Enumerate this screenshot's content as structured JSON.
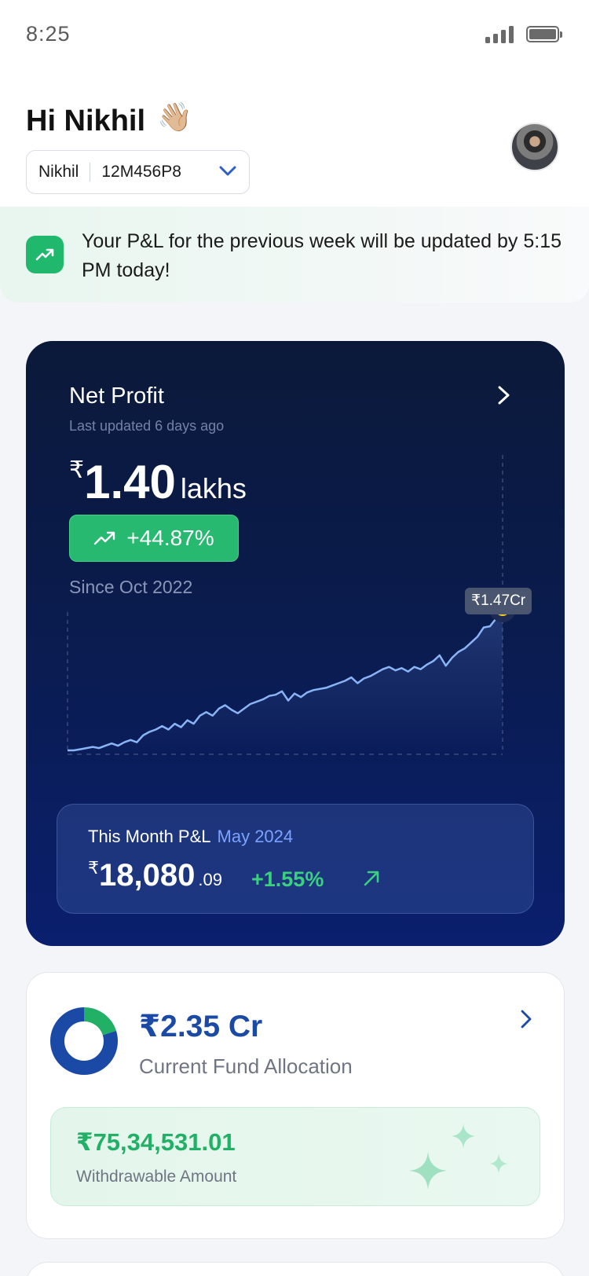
{
  "status_bar": {
    "time": "8:25"
  },
  "header": {
    "greeting": "Hi Nikhil",
    "wave_emoji": "👋🏼",
    "account_name": "Nikhil",
    "account_code": "12M456P8"
  },
  "notice": {
    "text": "Your P&L for the previous week will be updated by 5:15 PM today!"
  },
  "net_profit": {
    "title": "Net Profit",
    "updated": "Last updated 6 days ago",
    "currency": "₹",
    "value": "1.40",
    "unit": "lakhs",
    "change": "+44.87%",
    "since": "Since Oct 2022",
    "tooltip": "₹1.47Cr"
  },
  "chart_data": {
    "type": "line",
    "series": [
      {
        "values": [
          0.02,
          0.02,
          0.03,
          0.04,
          0.05,
          0.04,
          0.06,
          0.08,
          0.06,
          0.09,
          0.11,
          0.09,
          0.15,
          0.18,
          0.2,
          0.23,
          0.2,
          0.25,
          0.22,
          0.28,
          0.25,
          0.32,
          0.35,
          0.32,
          0.38,
          0.41,
          0.37,
          0.34,
          0.38,
          0.42,
          0.44,
          0.46,
          0.49,
          0.5,
          0.53,
          0.45,
          0.51,
          0.48,
          0.52,
          0.54,
          0.55,
          0.56,
          0.58,
          0.6,
          0.62,
          0.65,
          0.6,
          0.64,
          0.66,
          0.69,
          0.72,
          0.74,
          0.71,
          0.73,
          0.7,
          0.74,
          0.72,
          0.76,
          0.79,
          0.84,
          0.75,
          0.82,
          0.87,
          0.9,
          0.95,
          1.0,
          1.08,
          1.09,
          1.16,
          1.24
        ]
      }
    ],
    "end_label": "₹1.47Cr",
    "colors": {
      "line": "#8ab4f5",
      "marker": "#f5d020"
    }
  },
  "month_pnl": {
    "label": "This Month P&L",
    "month": "May 2024",
    "currency": "₹",
    "value": "18,080",
    "decimal": ".09",
    "change": "+1.55%"
  },
  "fund": {
    "value": "₹2.35 Cr",
    "label": "Current Fund Allocation",
    "allocation_shares": [
      0.8,
      0.2
    ],
    "colors": [
      "#1b4aa6",
      "#22b066"
    ]
  },
  "withdrawable": {
    "value": "₹75,34,531.01",
    "label": "Withdrawable Amount"
  },
  "icons": {
    "status": [
      "signal-icon",
      "battery-icon"
    ],
    "header": [
      "wave-icon",
      "chevron-down-icon",
      "avatar"
    ],
    "notice": "trending-up-icon",
    "card": [
      "chevron-right-icon",
      "trending-up-icon",
      "arrow-up-right-icon"
    ],
    "fund": [
      "donut-chart-icon",
      "chevron-right-icon",
      "sparkle-icon"
    ]
  }
}
